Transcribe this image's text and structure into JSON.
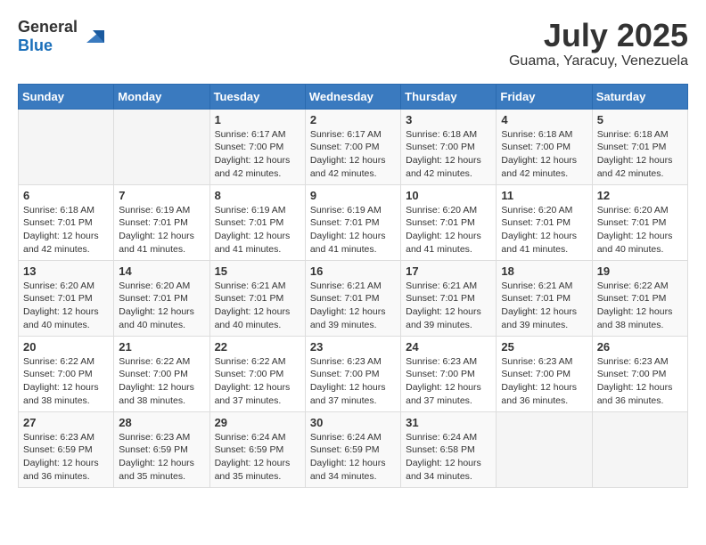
{
  "header": {
    "logo_general": "General",
    "logo_blue": "Blue",
    "month_title": "July 2025",
    "location": "Guama, Yaracuy, Venezuela"
  },
  "days_of_week": [
    "Sunday",
    "Monday",
    "Tuesday",
    "Wednesday",
    "Thursday",
    "Friday",
    "Saturday"
  ],
  "weeks": [
    [
      {
        "day": "",
        "info": ""
      },
      {
        "day": "",
        "info": ""
      },
      {
        "day": "1",
        "info": "Sunrise: 6:17 AM\nSunset: 7:00 PM\nDaylight: 12 hours\nand 42 minutes."
      },
      {
        "day": "2",
        "info": "Sunrise: 6:17 AM\nSunset: 7:00 PM\nDaylight: 12 hours\nand 42 minutes."
      },
      {
        "day": "3",
        "info": "Sunrise: 6:18 AM\nSunset: 7:00 PM\nDaylight: 12 hours\nand 42 minutes."
      },
      {
        "day": "4",
        "info": "Sunrise: 6:18 AM\nSunset: 7:00 PM\nDaylight: 12 hours\nand 42 minutes."
      },
      {
        "day": "5",
        "info": "Sunrise: 6:18 AM\nSunset: 7:01 PM\nDaylight: 12 hours\nand 42 minutes."
      }
    ],
    [
      {
        "day": "6",
        "info": "Sunrise: 6:18 AM\nSunset: 7:01 PM\nDaylight: 12 hours\nand 42 minutes."
      },
      {
        "day": "7",
        "info": "Sunrise: 6:19 AM\nSunset: 7:01 PM\nDaylight: 12 hours\nand 41 minutes."
      },
      {
        "day": "8",
        "info": "Sunrise: 6:19 AM\nSunset: 7:01 PM\nDaylight: 12 hours\nand 41 minutes."
      },
      {
        "day": "9",
        "info": "Sunrise: 6:19 AM\nSunset: 7:01 PM\nDaylight: 12 hours\nand 41 minutes."
      },
      {
        "day": "10",
        "info": "Sunrise: 6:20 AM\nSunset: 7:01 PM\nDaylight: 12 hours\nand 41 minutes."
      },
      {
        "day": "11",
        "info": "Sunrise: 6:20 AM\nSunset: 7:01 PM\nDaylight: 12 hours\nand 41 minutes."
      },
      {
        "day": "12",
        "info": "Sunrise: 6:20 AM\nSunset: 7:01 PM\nDaylight: 12 hours\nand 40 minutes."
      }
    ],
    [
      {
        "day": "13",
        "info": "Sunrise: 6:20 AM\nSunset: 7:01 PM\nDaylight: 12 hours\nand 40 minutes."
      },
      {
        "day": "14",
        "info": "Sunrise: 6:20 AM\nSunset: 7:01 PM\nDaylight: 12 hours\nand 40 minutes."
      },
      {
        "day": "15",
        "info": "Sunrise: 6:21 AM\nSunset: 7:01 PM\nDaylight: 12 hours\nand 40 minutes."
      },
      {
        "day": "16",
        "info": "Sunrise: 6:21 AM\nSunset: 7:01 PM\nDaylight: 12 hours\nand 39 minutes."
      },
      {
        "day": "17",
        "info": "Sunrise: 6:21 AM\nSunset: 7:01 PM\nDaylight: 12 hours\nand 39 minutes."
      },
      {
        "day": "18",
        "info": "Sunrise: 6:21 AM\nSunset: 7:01 PM\nDaylight: 12 hours\nand 39 minutes."
      },
      {
        "day": "19",
        "info": "Sunrise: 6:22 AM\nSunset: 7:01 PM\nDaylight: 12 hours\nand 38 minutes."
      }
    ],
    [
      {
        "day": "20",
        "info": "Sunrise: 6:22 AM\nSunset: 7:00 PM\nDaylight: 12 hours\nand 38 minutes."
      },
      {
        "day": "21",
        "info": "Sunrise: 6:22 AM\nSunset: 7:00 PM\nDaylight: 12 hours\nand 38 minutes."
      },
      {
        "day": "22",
        "info": "Sunrise: 6:22 AM\nSunset: 7:00 PM\nDaylight: 12 hours\nand 37 minutes."
      },
      {
        "day": "23",
        "info": "Sunrise: 6:23 AM\nSunset: 7:00 PM\nDaylight: 12 hours\nand 37 minutes."
      },
      {
        "day": "24",
        "info": "Sunrise: 6:23 AM\nSunset: 7:00 PM\nDaylight: 12 hours\nand 37 minutes."
      },
      {
        "day": "25",
        "info": "Sunrise: 6:23 AM\nSunset: 7:00 PM\nDaylight: 12 hours\nand 36 minutes."
      },
      {
        "day": "26",
        "info": "Sunrise: 6:23 AM\nSunset: 7:00 PM\nDaylight: 12 hours\nand 36 minutes."
      }
    ],
    [
      {
        "day": "27",
        "info": "Sunrise: 6:23 AM\nSunset: 6:59 PM\nDaylight: 12 hours\nand 36 minutes."
      },
      {
        "day": "28",
        "info": "Sunrise: 6:23 AM\nSunset: 6:59 PM\nDaylight: 12 hours\nand 35 minutes."
      },
      {
        "day": "29",
        "info": "Sunrise: 6:24 AM\nSunset: 6:59 PM\nDaylight: 12 hours\nand 35 minutes."
      },
      {
        "day": "30",
        "info": "Sunrise: 6:24 AM\nSunset: 6:59 PM\nDaylight: 12 hours\nand 34 minutes."
      },
      {
        "day": "31",
        "info": "Sunrise: 6:24 AM\nSunset: 6:58 PM\nDaylight: 12 hours\nand 34 minutes."
      },
      {
        "day": "",
        "info": ""
      },
      {
        "day": "",
        "info": ""
      }
    ]
  ]
}
